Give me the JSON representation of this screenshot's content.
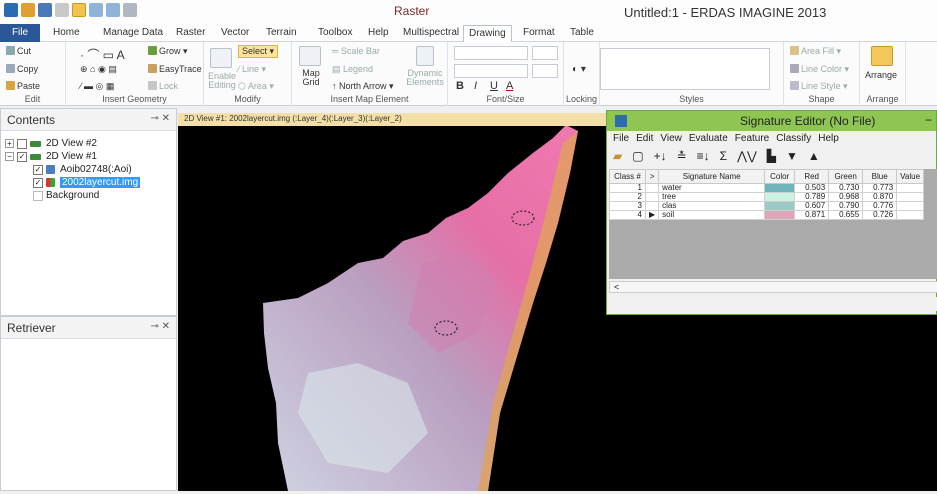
{
  "window": {
    "app_title": "Untitled:1 - ERDAS IMAGINE 2013",
    "context_tab_group": "Raster"
  },
  "tabs": [
    "File",
    "Home",
    "Manage Data",
    "Raster",
    "Vector",
    "Terrain",
    "Toolbox",
    "Help",
    "Multispectral",
    "Drawing",
    "Format",
    "Table"
  ],
  "ribbon": {
    "edit": {
      "label": "Edit",
      "cut": "Cut",
      "copy": "Copy",
      "paste": "Paste"
    },
    "insert_geometry": {
      "label": "Insert Geometry",
      "grow": "Grow",
      "easytrace": "EasyTrace",
      "lock": "Lock"
    },
    "modify": {
      "label": "Modify",
      "enable_editing": "Enable Editing",
      "select": "Select",
      "line": "Line",
      "area": "Area"
    },
    "insert_map_element": {
      "label": "Insert Map Element",
      "map_grid": "Map Grid",
      "scale_bar": "Scale Bar",
      "legend": "Legend",
      "north_arrow": "North Arrow",
      "dynamic_elements": "Dynamic Elements"
    },
    "font_size": {
      "label": "Font/Size",
      "bold": "B",
      "italic": "I",
      "underline": "U",
      "font_a": "A"
    },
    "locking": {
      "label": "Locking"
    },
    "styles": {
      "label": "Styles"
    },
    "shape": {
      "label": "Shape",
      "area_fill": "Area Fill",
      "line_color": "Line Color",
      "line_style": "Line Style"
    },
    "arrange": {
      "label": "Arrange",
      "button": "Arrange"
    }
  },
  "contents": {
    "title": "Contents",
    "items": [
      {
        "label": "2D View #2"
      },
      {
        "label": "2D View #1"
      },
      {
        "label": "Aoib02748(:Aoi)"
      },
      {
        "label": "2002layercut.img"
      },
      {
        "label": "Background"
      }
    ]
  },
  "retriever": {
    "title": "Retriever"
  },
  "view": {
    "header": "2D View #1: 2002layercut.img (:Layer_4)(:Layer_3)(:Layer_2)"
  },
  "signature_editor": {
    "title": "Signature Editor (No File)",
    "menu": [
      "File",
      "Edit",
      "View",
      "Evaluate",
      "Feature",
      "Classify",
      "Help"
    ],
    "columns": [
      "Class #",
      ">",
      "Signature Name",
      "Color",
      "Red",
      "Green",
      "Blue",
      "Value"
    ],
    "rows": [
      {
        "class": "1",
        "marker": "",
        "name": "water",
        "color": "#6fb3bb",
        "red": "0.503",
        "green": "0.730",
        "blue": "0.773"
      },
      {
        "class": "2",
        "marker": "",
        "name": "tree",
        "color": "#c9f2e0",
        "red": "0.789",
        "green": "0.968",
        "blue": "0.870"
      },
      {
        "class": "3",
        "marker": "",
        "name": "clas",
        "color": "#9bcac6",
        "red": "0.607",
        "green": "0.790",
        "blue": "0.776"
      },
      {
        "class": "4",
        "marker": "▶",
        "name": "soil",
        "color": "#dea7b9",
        "red": "0.871",
        "green": "0.655",
        "blue": "0.726"
      }
    ],
    "scroll_left": "<"
  },
  "colors": {
    "file_tab": "#2b5797",
    "editor_titlebar": "#8ec553",
    "view_header": "#f4dfa8",
    "select_highlight": "#fde29a"
  }
}
